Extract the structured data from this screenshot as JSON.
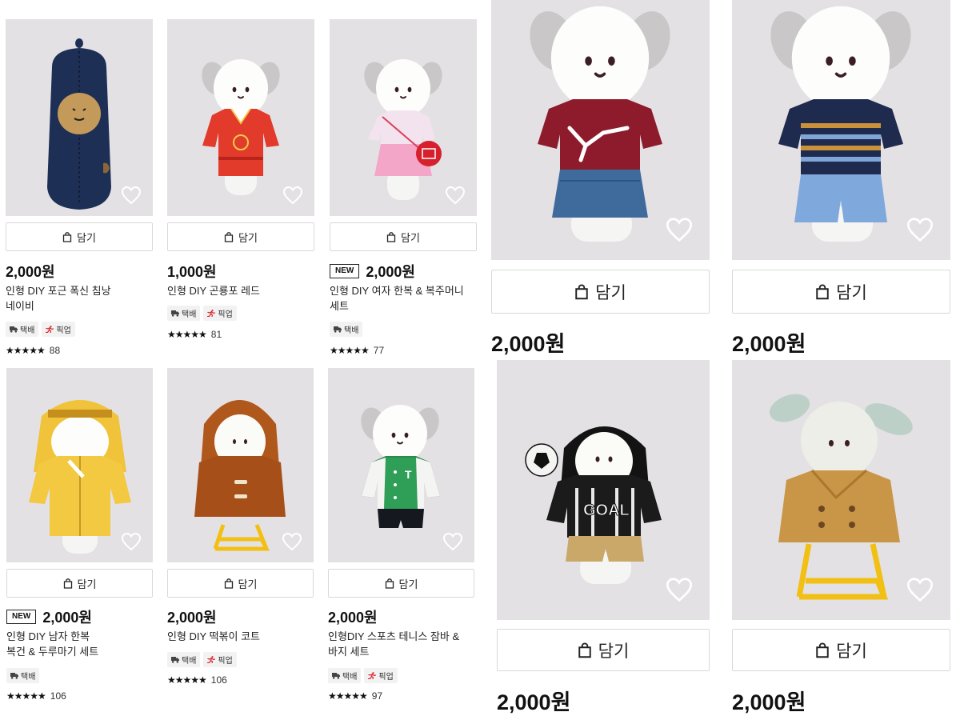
{
  "labels": {
    "cart": "담기",
    "new": "NEW",
    "delivery": "택배",
    "pickup": "픽업"
  },
  "colors": {
    "photo_bg": "#e4e1e4",
    "text": "#111111",
    "border": "#d9d9d9",
    "tag_bg": "#f2f2f2",
    "pickup_red": "#d9262b"
  },
  "icons": {
    "cart": "shopping-bag-icon",
    "favorite": "heart-outline-icon",
    "delivery": "truck-icon",
    "pickup": "runner-icon",
    "rating": "star-icon"
  },
  "products": [
    {
      "price": "2,000원",
      "name_line1": "인형 DIY 포근 폭신 침낭",
      "name_line2": "네이비",
      "stars": "★★★★★",
      "reviews": "88",
      "outfit": "sleeping-bag-navy"
    },
    {
      "price": "1,000원",
      "name_line1": "인형 DIY 곤룡포 레드",
      "name_line2": "",
      "stars": "★★★★★",
      "reviews": "81",
      "outfit": "red-royal-robe"
    },
    {
      "price": "2,000원",
      "name_line1": "인형 DIY 여자 한복 & 복주머니",
      "name_line2": "세트",
      "stars": "★★★★★",
      "reviews": "77",
      "outfit": "pink-hanbok-lucky-pouch"
    },
    {
      "price": "2,000원",
      "outfit": "red-knit-sweater-denim-skirt"
    },
    {
      "price": "2,000원",
      "outfit": "navy-striped-knit-blue-pants"
    },
    {
      "price": "2,000원",
      "name_line1": "인형 DIY 남자 한복",
      "name_line2": "복건 & 두루마기 세트",
      "stars": "★★★★★",
      "reviews": "106",
      "outfit": "yellow-hanbok-hood"
    },
    {
      "price": "2,000원",
      "name_line1": "인형 DIY 떡볶이 코트",
      "name_line2": "",
      "stars": "★★★★★",
      "reviews": "106",
      "outfit": "brown-duffle-coat"
    },
    {
      "price": "2,000원",
      "name_line1": "인형DIY 스포츠 테니스 잠바 &",
      "name_line2": "바지 세트",
      "stars": "★★★★★",
      "reviews": "97",
      "outfit": "green-varsity-jacket"
    },
    {
      "price": "2,000원",
      "outfit": "black-goal-hoodie-soccer"
    },
    {
      "price": "2,000원",
      "outfit": "tan-trench-coat"
    }
  ]
}
